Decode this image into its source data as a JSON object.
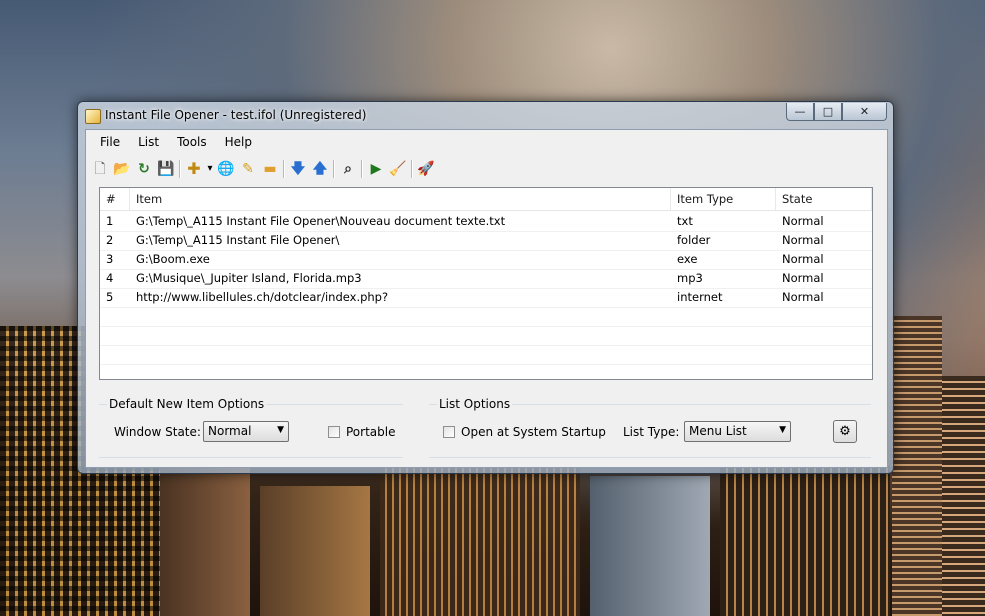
{
  "window": {
    "title": "Instant File Opener - test.ifol (Unregistered)",
    "minimize": "—",
    "maximize": "□",
    "close": "✕"
  },
  "menu": [
    "File",
    "List",
    "Tools",
    "Help"
  ],
  "toolbar": {
    "icons": {
      "new": "🗋",
      "open": "📂",
      "reload": "↻",
      "save": "💾",
      "add": "✚",
      "add_dropdown": "▾",
      "web": "🌐",
      "edit": "✎",
      "remove": "▬",
      "move_down": "🡇",
      "move_up": "🡅",
      "find": "⌕",
      "run": "▶",
      "clean": "🧹",
      "launch": "🚀"
    }
  },
  "list": {
    "columns": [
      "#",
      "Item",
      "Item Type",
      "State"
    ],
    "rows": [
      {
        "num": "1",
        "item": "G:\\Temp\\_A115 Instant File Opener\\Nouveau document texte.txt",
        "type": "txt",
        "state": "Normal"
      },
      {
        "num": "2",
        "item": "G:\\Temp\\_A115 Instant File Opener\\",
        "type": "folder",
        "state": "Normal"
      },
      {
        "num": "3",
        "item": "G:\\Boom.exe",
        "type": "exe",
        "state": "Normal"
      },
      {
        "num": "4",
        "item": "G:\\Musique\\_Jupiter Island, Florida.mp3",
        "type": "mp3",
        "state": "Normal"
      },
      {
        "num": "5",
        "item": "http://www.libellules.ch/dotclear/index.php?",
        "type": "internet",
        "state": "Normal"
      }
    ]
  },
  "default_options": {
    "title": "Default New Item Options",
    "window_state_label": "Window State:",
    "window_state_value": "Normal",
    "portable_label": "Portable"
  },
  "list_options": {
    "title": "List Options",
    "startup_label": "Open at System Startup",
    "list_type_label": "List Type:",
    "list_type_value": "Menu List",
    "settings_icon": "⚙"
  }
}
